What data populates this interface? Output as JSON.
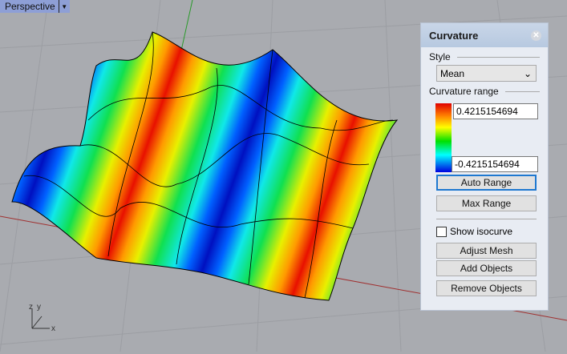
{
  "viewport": {
    "title": "Perspective",
    "axes": {
      "x": "x",
      "y": "y",
      "z": "z"
    }
  },
  "panel": {
    "title": "Curvature",
    "style_label": "Style",
    "style_value": "Mean",
    "range_label": "Curvature range",
    "max_value": "0.4215154694",
    "min_value": "-0.4215154694",
    "auto_range": "Auto Range",
    "max_range": "Max Range",
    "show_isocurve": "Show isocurve",
    "show_isocurve_checked": false,
    "adjust_mesh": "Adjust Mesh",
    "add_objects": "Add Objects",
    "remove_objects": "Remove Objects"
  }
}
